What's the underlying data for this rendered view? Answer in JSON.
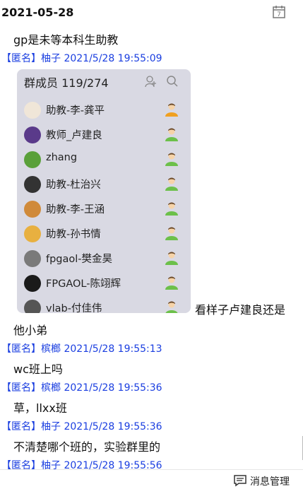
{
  "date": "2021-05-28",
  "messages": [
    {
      "text": "gp是未等本科生助教",
      "tag": "【匿名】",
      "meta": "柚子 2021/5/28 19:55:09"
    },
    {
      "text": "他小弟",
      "tag": "【匿名】",
      "meta": "槟榔 2021/5/28 19:55:13"
    },
    {
      "text": "wc班上吗",
      "tag": "【匿名】",
      "meta": "槟榔 2021/5/28 19:55:36"
    },
    {
      "text": "草，llxx班",
      "tag": "【匿名】",
      "meta": "柚子 2021/5/28 19:55:36"
    },
    {
      "text": "不清楚哪个班的，实验群里的",
      "tag": "【匿名】",
      "meta": "柚子 2021/5/28 19:55:56"
    }
  ],
  "side_note": "看样子卢建良还是",
  "group": {
    "header": "群成员 119/274",
    "members": [
      {
        "name": "助教-李-龚平",
        "avatar_color": "#f0e6d8",
        "status": "orange"
      },
      {
        "name": "教师_卢建良",
        "avatar_color": "#5a3a8a",
        "status": "green"
      },
      {
        "name": "zhang",
        "avatar_color": "#5aa03a",
        "status": "green"
      },
      {
        "name": "助教-杜治兴",
        "avatar_color": "#333333",
        "status": "green"
      },
      {
        "name": "助教-李-王涵",
        "avatar_color": "#d08a3a",
        "status": "green"
      },
      {
        "name": "助教-孙书情",
        "avatar_color": "#e8b040",
        "status": "green"
      },
      {
        "name": "fpgaol-樊金昊",
        "avatar_color": "#7a7a7a",
        "status": "green"
      },
      {
        "name": "FPGAOL-陈翊辉",
        "avatar_color": "#1a1a1a",
        "status": "green"
      },
      {
        "name": "vlab-付佳伟",
        "avatar_color": "#555555",
        "status": "green"
      }
    ]
  },
  "footer": {
    "label": "消息管理"
  }
}
